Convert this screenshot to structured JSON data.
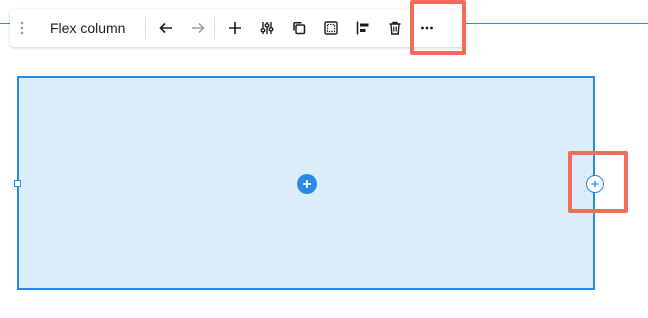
{
  "toolbar": {
    "block_title": "Flex column",
    "buttons": [
      {
        "id": "undo",
        "icon": "arrow-left-icon",
        "enabled": true
      },
      {
        "id": "redo",
        "icon": "arrow-right-icon",
        "enabled": false
      },
      {
        "id": "add",
        "icon": "plus-icon"
      },
      {
        "id": "settings",
        "icon": "sliders-icon"
      },
      {
        "id": "duplicate",
        "icon": "copy-icon"
      },
      {
        "id": "select-parent",
        "icon": "dashed-square-icon"
      },
      {
        "id": "align",
        "icon": "align-left-icon"
      },
      {
        "id": "delete",
        "icon": "trash-icon"
      },
      {
        "id": "more",
        "icon": "more-horizontal-icon"
      }
    ]
  },
  "colors": {
    "accent": "#2a8ae8",
    "block_fill": "#ddecfb",
    "highlight": "#f26b5b",
    "icon": "#1e1e1e",
    "icon_disabled": "#a0a0a0"
  },
  "canvas": {
    "center_inserter_icon": "plus-circle-filled-icon",
    "side_inserter_icon": "plus-circle-outline-icon"
  }
}
